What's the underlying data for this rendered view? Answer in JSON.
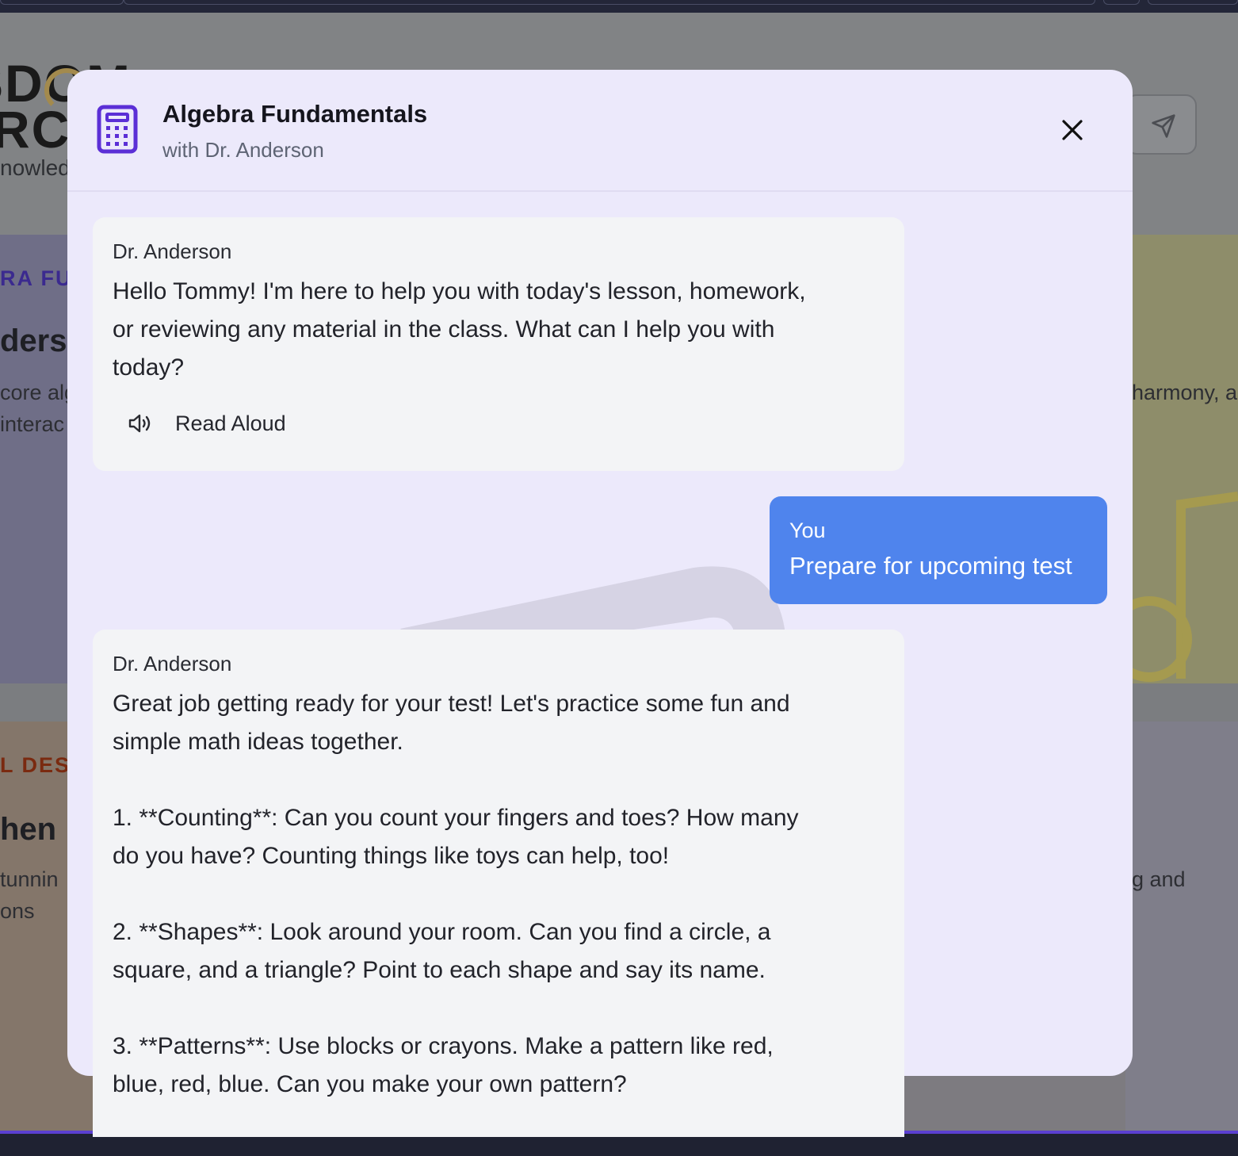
{
  "background": {
    "logo_line1": "SDOM",
    "logo_line2": "RC",
    "tagline": "nowled",
    "card1_label": "RA FU",
    "card1_heading": "ders",
    "card1_desc_line1": "core alg",
    "card1_desc_line2": "interac",
    "card1_right_desc": "harmony, a",
    "card2_label": "L DES",
    "card2_heading": "hen",
    "card2_desc_line1": "tunnin",
    "card2_desc_line2": "ons",
    "card2_right_desc": "g and"
  },
  "modal": {
    "title": "Algebra Fundamentals",
    "subtitle": "with Dr. Anderson",
    "icon": "calculator-icon",
    "close_icon": "close-icon"
  },
  "messages": [
    {
      "sender": "Dr. Anderson",
      "text": "Hello Tommy! I'm here to help you with today's lesson, homework,\nor reviewing any material in the class. What can I help you with\ntoday?",
      "read_aloud_label": "Read Aloud"
    },
    {
      "sender": "You",
      "text": "Prepare for upcoming test"
    },
    {
      "sender": "Dr. Anderson",
      "text": "Great job getting ready for your test! Let's practice some fun and\nsimple math ideas together.\n\n1. **Counting**: Can you count your fingers and toes? How many\ndo you have? Counting things like toys can help, too!\n\n2. **Shapes**: Look around your room. Can you find a circle, a\nsquare, and a triangle? Point to each shape and say its name.\n\n3. **Patterns**: Use blocks or crayons. Make a pattern like red,\nblue, red, blue. Can you make your own pattern?"
    }
  ],
  "colors": {
    "modal_bg": "#ece9fb",
    "bot_bubble": "#f3f4f6",
    "user_bubble": "#4f84ed",
    "accent": "#5b2fd6"
  }
}
